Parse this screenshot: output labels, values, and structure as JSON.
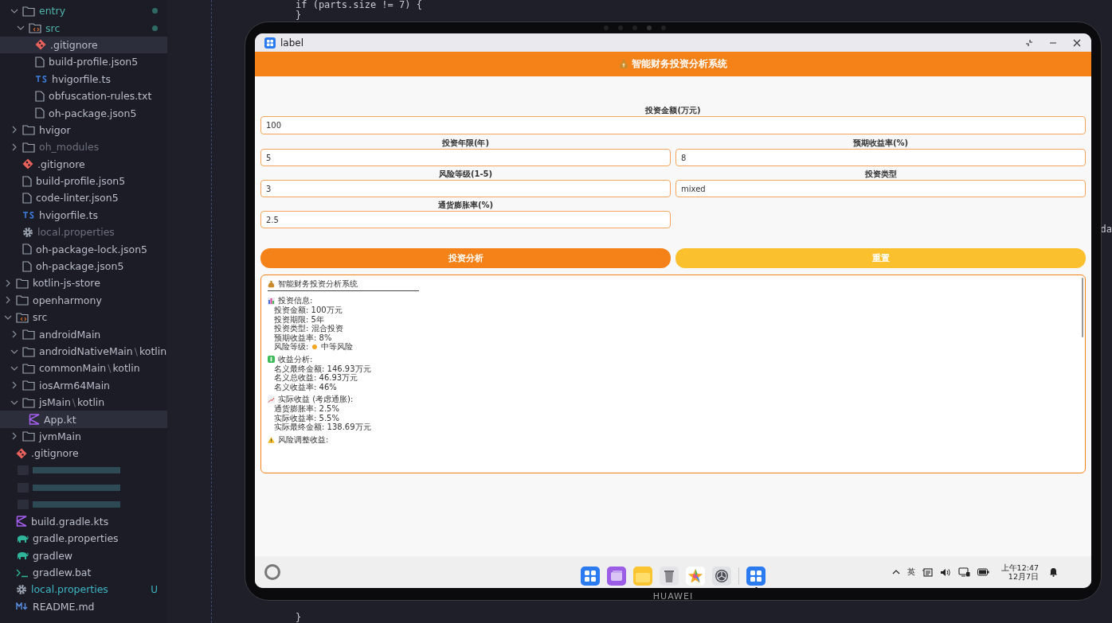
{
  "tree_continued": [
    {
      "name": "entry",
      "kind": "folder",
      "expanded": true,
      "highlight": true,
      "modified": true,
      "children": [
        {
          "name": "src",
          "kind": "folder-src",
          "expanded": true,
          "highlight": true,
          "modified": true,
          "children": [
            {
              "name": ".gitignore",
              "kind": "git",
              "selected": true
            },
            {
              "name": "build-profile.json5",
              "kind": "file",
              "selected": false
            },
            {
              "name": "hvigorfile.ts",
              "kind": "ts",
              "selected": false
            },
            {
              "name": "obfuscation-rules.txt",
              "kind": "file",
              "selected": false
            },
            {
              "name": "oh-package.json5",
              "kind": "file",
              "selected": false
            }
          ]
        }
      ]
    },
    {
      "name": "hvigor",
      "kind": "folder",
      "expanded": false
    },
    {
      "name": "oh_modules",
      "kind": "folder",
      "expanded": false,
      "dimmed": true
    },
    {
      "name": ".gitignore",
      "kind": "git",
      "selected": false
    },
    {
      "name": "build-profile.json5",
      "kind": "file",
      "selected": false
    },
    {
      "name": "code-linter.json5",
      "kind": "file",
      "selected": false
    },
    {
      "name": "hvigorfile.ts",
      "kind": "ts",
      "selected": false
    },
    {
      "name": "local.properties",
      "kind": "gear",
      "selected": false,
      "dimmed": true
    },
    {
      "name": "oh-package-lock.json5",
      "kind": "file",
      "selected": false
    },
    {
      "name": "oh-package.json5",
      "kind": "file",
      "selected": false
    }
  ],
  "tree": [
    {
      "name": "kotlin-js-store",
      "kind": "folder",
      "expanded": false
    },
    {
      "name": "openharmony",
      "kind": "folder",
      "expanded": false
    },
    {
      "name": "src",
      "kind": "folder-src",
      "expanded": true,
      "children": [
        {
          "name": "androidMain",
          "kind": "folder",
          "expanded": false
        },
        {
          "name": "androidNativeMain",
          "separator": "\\",
          "suffix": "kotlin",
          "kind": "folder",
          "expanded": true
        },
        {
          "name": "commonMain",
          "separator": "\\",
          "suffix": "kotlin",
          "kind": "folder",
          "expanded": true
        },
        {
          "name": "iosArm64Main",
          "kind": "folder",
          "expanded": false
        },
        {
          "name": "jsMain",
          "separator": "\\",
          "suffix": "kotlin",
          "kind": "folder",
          "expanded": true,
          "children": [
            {
              "name": "App.kt",
              "kind": "kotlin",
              "selected": true
            }
          ]
        },
        {
          "name": "jvmMain",
          "kind": "folder",
          "expanded": false
        }
      ]
    },
    {
      "name": ".gitignore",
      "kind": "git",
      "selected": false
    },
    {
      "kind": "blurred"
    },
    {
      "kind": "blurred"
    },
    {
      "kind": "blurred"
    },
    {
      "name": "build.gradle.kts",
      "kind": "kotlin",
      "selected": false
    },
    {
      "name": "gradle.properties",
      "kind": "gradle",
      "selected": false
    },
    {
      "name": "gradlew",
      "kind": "gradle",
      "selected": false
    },
    {
      "name": "gradlew.bat",
      "kind": "terminal",
      "selected": false
    },
    {
      "name": "local.properties",
      "kind": "gear",
      "selected": false,
      "git_status": "U"
    },
    {
      "name": "README.md",
      "kind": "markdown",
      "selected": false
    }
  ],
  "code": {
    "top_lines": [
      "if (parts.size != 7) {",
      "}"
    ],
    "bottom_line": "}",
    "edge_fragment": "da"
  },
  "emulator": {
    "brand": "HUAWEI",
    "window": {
      "title": "label"
    },
    "app": {
      "header": "智能财务投资分析系统",
      "fields": [
        {
          "label": "投资金额(万元)",
          "value": "100",
          "wide": true
        },
        {
          "label": "投资年限(年)",
          "value": "5",
          "wide": false
        },
        {
          "label": "预期收益率(%)",
          "value": "8",
          "wide": false
        },
        {
          "label": "风险等级(1-5)",
          "value": "3",
          "wide": false
        },
        {
          "label": "投资类型",
          "value": "mixed",
          "wide": false
        },
        {
          "label": "通货膨胀率(%)",
          "value": "2.5",
          "wide": false
        }
      ],
      "buttons": [
        {
          "label": "投资分析",
          "kind": "primary"
        },
        {
          "label": "重置",
          "kind": "secondary"
        }
      ],
      "result": {
        "title": "智能财务投资分析系统",
        "sections": [
          {
            "kind": "chart",
            "heading": "投资信息:",
            "lines": [
              {
                "text": "投资金额: 100万元"
              },
              {
                "text": "投资期限: 5年"
              },
              {
                "text": "投资类型: 混合投资"
              },
              {
                "text": "预期收益率: 8%"
              },
              {
                "text": "风险等级:",
                "color": "#f5a623",
                "after": "中等风险"
              }
            ]
          },
          {
            "kind": "money",
            "heading": "收益分析:",
            "lines": [
              {
                "text": "名义最终金额: 146.93万元"
              },
              {
                "text": "名义总收益: 46.93万元"
              },
              {
                "text": "名义收益率: 46%"
              }
            ]
          },
          {
            "kind": "trend",
            "heading": "实际收益 (考虑通胀):",
            "lines": [
              {
                "text": "通货膨胀率: 2.5%"
              },
              {
                "text": "实际收益率: 5.5%"
              },
              {
                "text": "实际最终金额: 138.69万元"
              }
            ]
          },
          {
            "kind": "warning",
            "heading": "风险调整收益:"
          }
        ]
      }
    },
    "taskbar": {
      "apps": [
        {
          "kind": "grid",
          "running": false
        },
        {
          "kind": "window",
          "running": false
        },
        {
          "kind": "folder",
          "running": false
        },
        {
          "kind": "trash",
          "running": false
        },
        {
          "kind": "star",
          "running": false
        },
        {
          "kind": "gear",
          "running": false
        },
        {
          "kind": "grid",
          "running": true
        }
      ],
      "tray": {
        "input": "英",
        "time": "上午12:47",
        "date": "12月7日"
      }
    }
  }
}
